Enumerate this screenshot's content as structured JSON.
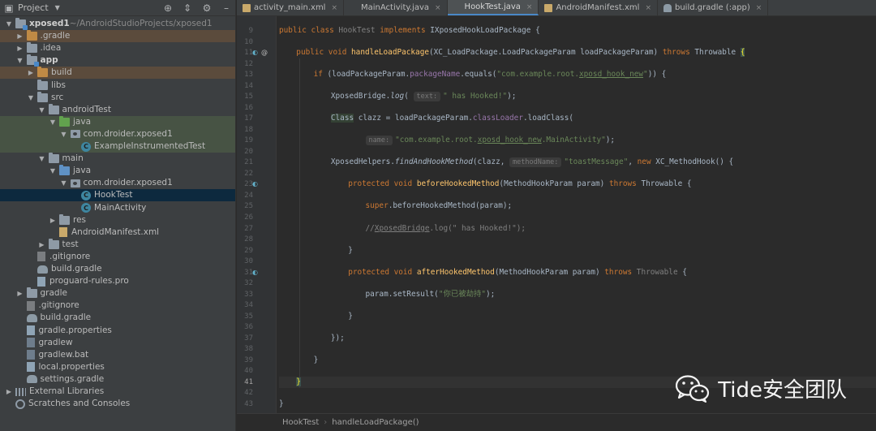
{
  "project_panel": {
    "title": "Project",
    "tree": [
      {
        "label": "xposed1",
        "suffix": " ~/AndroidStudioProjects/xposed1",
        "depth": 0,
        "arrow": "down",
        "icon": "module-folder",
        "bold": true
      },
      {
        "label": ".gradle",
        "depth": 1,
        "arrow": "right",
        "icon": "folder-orange",
        "hl": "brown"
      },
      {
        "label": ".idea",
        "depth": 1,
        "arrow": "right",
        "icon": "folder"
      },
      {
        "label": "app",
        "depth": 1,
        "arrow": "down",
        "icon": "module-folder",
        "bold": true
      },
      {
        "label": "build",
        "depth": 2,
        "arrow": "right",
        "icon": "folder-orange",
        "hl": "brown"
      },
      {
        "label": "libs",
        "depth": 2,
        "arrow": "",
        "icon": "folder"
      },
      {
        "label": "src",
        "depth": 2,
        "arrow": "down",
        "icon": "folder"
      },
      {
        "label": "androidTest",
        "depth": 3,
        "arrow": "down",
        "icon": "folder"
      },
      {
        "label": "java",
        "depth": 4,
        "arrow": "down",
        "icon": "folder-green",
        "hl": "green"
      },
      {
        "label": "com.droider.xposed1",
        "depth": 5,
        "arrow": "down",
        "icon": "package",
        "hl": "green"
      },
      {
        "label": "ExampleInstrumentedTest",
        "depth": 6,
        "arrow": "",
        "icon": "class",
        "hl": "green"
      },
      {
        "label": "main",
        "depth": 3,
        "arrow": "down",
        "icon": "folder"
      },
      {
        "label": "java",
        "depth": 4,
        "arrow": "down",
        "icon": "folder-blue"
      },
      {
        "label": "com.droider.xposed1",
        "depth": 5,
        "arrow": "down",
        "icon": "package"
      },
      {
        "label": "HookTest",
        "depth": 6,
        "arrow": "",
        "icon": "class",
        "hl": "selected"
      },
      {
        "label": "MainActivity",
        "depth": 6,
        "arrow": "",
        "icon": "class"
      },
      {
        "label": "res",
        "depth": 4,
        "arrow": "right",
        "icon": "folder-res"
      },
      {
        "label": "AndroidManifest.xml",
        "depth": 4,
        "arrow": "",
        "icon": "file-xml"
      },
      {
        "label": "test",
        "depth": 3,
        "arrow": "right",
        "icon": "folder"
      },
      {
        "label": ".gitignore",
        "depth": 2,
        "arrow": "",
        "icon": "file-git"
      },
      {
        "label": "build.gradle",
        "depth": 2,
        "arrow": "",
        "icon": "gradle"
      },
      {
        "label": "proguard-rules.pro",
        "depth": 2,
        "arrow": "",
        "icon": "file-props"
      },
      {
        "label": "gradle",
        "depth": 1,
        "arrow": "right",
        "icon": "folder"
      },
      {
        "label": ".gitignore",
        "depth": 1,
        "arrow": "",
        "icon": "file-git"
      },
      {
        "label": "build.gradle",
        "depth": 1,
        "arrow": "",
        "icon": "gradle"
      },
      {
        "label": "gradle.properties",
        "depth": 1,
        "arrow": "",
        "icon": "file-props"
      },
      {
        "label": "gradlew",
        "depth": 1,
        "arrow": "",
        "icon": "file-bat"
      },
      {
        "label": "gradlew.bat",
        "depth": 1,
        "arrow": "",
        "icon": "file-bat"
      },
      {
        "label": "local.properties",
        "depth": 1,
        "arrow": "",
        "icon": "file-props"
      },
      {
        "label": "settings.gradle",
        "depth": 1,
        "arrow": "",
        "icon": "gradle"
      },
      {
        "label": "External Libraries",
        "depth": 0,
        "arrow": "right",
        "icon": "libs"
      },
      {
        "label": "Scratches and Consoles",
        "depth": 0,
        "arrow": "",
        "icon": "scratch"
      }
    ]
  },
  "tabs": [
    {
      "label": "activity_main.xml",
      "icon": "xml"
    },
    {
      "label": "MainActivity.java",
      "icon": "class"
    },
    {
      "label": "HookTest.java",
      "icon": "class",
      "active": true
    },
    {
      "label": "AndroidManifest.xml",
      "icon": "xml"
    },
    {
      "label": "build.gradle (:app)",
      "icon": "gradle"
    }
  ],
  "code": {
    "line_numbers": [
      "9",
      "10",
      "11",
      "12",
      "13",
      "14",
      "15",
      "16",
      "17",
      "18",
      "19",
      "20",
      "21",
      "22",
      "23",
      "24",
      "25",
      "26",
      "27",
      "28",
      "29",
      "30",
      "31",
      "32",
      "33",
      "34",
      "35",
      "36",
      "37",
      "38",
      "39",
      "40",
      "41",
      "42",
      "43"
    ],
    "current_line": "41",
    "text": {
      "l9_kw1": "public class ",
      "l9_cls": "HookTest ",
      "l9_kw2": "implements ",
      "l9_iface": "IXposedHookLoadPackage {",
      "l11_kw": "public void ",
      "l11_fn": "handleLoadPackage",
      "l11_args": "(XC_LoadPackage.LoadPackageParam loadPackageParam) ",
      "l11_throws": "throws ",
      "l11_tw": "Throwable ",
      "l11_brace": "{",
      "l13_if": "if ",
      "l13_a": "(loadPackageParam.",
      "l13_fld": "packageName",
      "l13_b": ".equals(",
      "l13_s1": "\"com.example.root.",
      "l13_s2": "xposd_hook_new",
      "l13_s3": "\"",
      "l13_c": ")) {",
      "l15_a": "XposedBridge.",
      "l15_fn": "log",
      "l15_b": "( ",
      "l15_hint": "text:",
      "l15_s": "\" has Hooked!\"",
      "l15_c": ");",
      "l17_cls": "Class",
      "l17_a": " clazz = loadPackageParam.",
      "l17_fld": "classLoader",
      "l17_b": ".loadClass(",
      "l19_hint": "name:",
      "l19_s1": "\"com.example.root.",
      "l19_s2": "xposd_hook_new",
      "l19_s3": ".MainActivity\"",
      "l19_c": ");",
      "l21_a": "XposedHelpers.",
      "l21_fn": "findAndHookMethod",
      "l21_b": "(clazz, ",
      "l21_hint": "methodName:",
      "l21_s": "\"toastMessage\"",
      "l21_c": ", ",
      "l21_new": "new ",
      "l21_d": "XC_MethodHook() {",
      "l23_kw": "protected void ",
      "l23_fn": "beforeHookedMethod",
      "l23_a": "(MethodHookParam param) ",
      "l23_throws": "throws ",
      "l23_b": "Throwable {",
      "l25_super": "super",
      "l25_a": ".beforeHookedMethod(param);",
      "l27_c1": "//",
      "l27_c2": "XposedBridge",
      "l27_c3": ".log(\" has Hooked!\");",
      "l29": "}",
      "l31_kw": "protected void ",
      "l31_fn": "afterHookedMethod",
      "l31_a": "(MethodHookParam param) ",
      "l31_throws": "throws ",
      "l31_tw": "Throwable",
      "l31_b": " {",
      "l33_a": "param.setResult(",
      "l33_s": "\"你已被劫持\"",
      "l33_c": ");",
      "l35": "}",
      "l37": "});",
      "l39": "}",
      "l41": "}",
      "l43": "}"
    }
  },
  "breadcrumb": {
    "items": [
      "HookTest",
      "handleLoadPackage()"
    ],
    "separator": "›"
  },
  "watermark": {
    "text": "Tide安全团队"
  },
  "colors": {
    "keyword": "#cc7832",
    "function": "#ffc66d",
    "string": "#6a8759",
    "field": "#9876aa",
    "comment": "#808080",
    "accent": "#4a88c7"
  }
}
